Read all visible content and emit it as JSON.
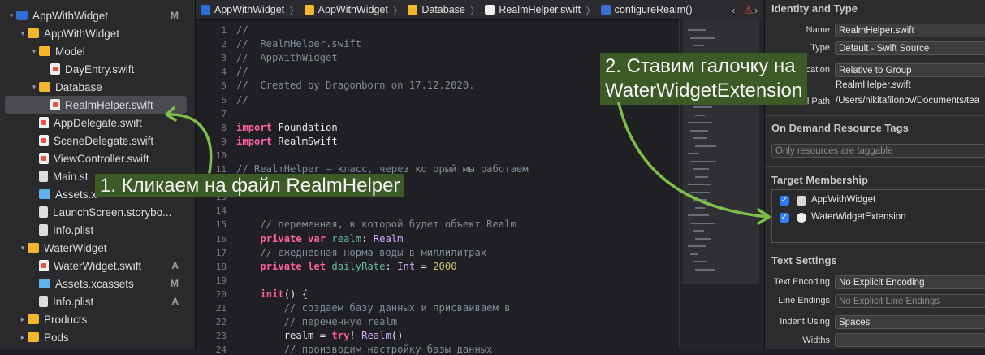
{
  "navigator": {
    "items": [
      {
        "label": "AppWithWidget",
        "badge": "M",
        "level": 0,
        "icon": "xcode-project-icon",
        "disc": "▾"
      },
      {
        "label": "AppWithWidget",
        "badge": "",
        "level": 1,
        "icon": "folder-icon",
        "disc": "▾"
      },
      {
        "label": "Model",
        "badge": "",
        "level": 2,
        "icon": "folder-icon",
        "disc": "▾"
      },
      {
        "label": "DayEntry.swift",
        "badge": "",
        "level": 3,
        "icon": "swift-file-icon",
        "disc": ""
      },
      {
        "label": "Database",
        "badge": "",
        "level": 2,
        "icon": "folder-icon",
        "disc": "▾"
      },
      {
        "label": "RealmHelper.swift",
        "badge": "",
        "level": 3,
        "icon": "swift-file-icon",
        "disc": "",
        "selected": true
      },
      {
        "label": "AppDelegate.swift",
        "badge": "",
        "level": 2,
        "icon": "swift-file-icon",
        "disc": ""
      },
      {
        "label": "SceneDelegate.swift",
        "badge": "",
        "level": 2,
        "icon": "swift-file-icon",
        "disc": ""
      },
      {
        "label": "ViewController.swift",
        "badge": "",
        "level": 2,
        "icon": "swift-file-icon",
        "disc": ""
      },
      {
        "label": "Main.st",
        "badge": "",
        "level": 2,
        "icon": "storyboard-icon",
        "disc": ""
      },
      {
        "label": "Assets.x",
        "badge": "",
        "level": 2,
        "icon": "assets-icon",
        "disc": ""
      },
      {
        "label": "LaunchScreen.storybo...",
        "badge": "",
        "level": 2,
        "icon": "storyboard-icon",
        "disc": ""
      },
      {
        "label": "Info.plist",
        "badge": "",
        "level": 2,
        "icon": "plist-icon",
        "disc": ""
      },
      {
        "label": "WaterWidget",
        "badge": "",
        "level": 1,
        "icon": "folder-icon",
        "disc": "▾"
      },
      {
        "label": "WaterWidget.swift",
        "badge": "A",
        "level": 2,
        "icon": "swift-file-icon",
        "disc": ""
      },
      {
        "label": "Assets.xcassets",
        "badge": "M",
        "level": 2,
        "icon": "assets-icon",
        "disc": ""
      },
      {
        "label": "Info.plist",
        "badge": "A",
        "level": 2,
        "icon": "plist-icon",
        "disc": ""
      },
      {
        "label": "Products",
        "badge": "",
        "level": 1,
        "icon": "folder-icon",
        "disc": "▸"
      },
      {
        "label": "Pods",
        "badge": "",
        "level": 1,
        "icon": "folder-icon",
        "disc": "▸"
      }
    ]
  },
  "jumpbar": {
    "crumbs": [
      "AppWithWidget",
      "AppWithWidget",
      "Database",
      "RealmHelper.swift",
      "configureRealm()"
    ],
    "sep": "〉",
    "buttons": [
      "‹",
      "⚠",
      "›"
    ]
  },
  "editor": {
    "lines": [
      {
        "n": "1",
        "t": "//",
        "k": "cm"
      },
      {
        "n": "2",
        "t": "//  RealmHelper.swift",
        "k": "cm"
      },
      {
        "n": "3",
        "t": "//  AppWithWidget",
        "k": "cm"
      },
      {
        "n": "4",
        "t": "//",
        "k": "cm"
      },
      {
        "n": "5",
        "t": "//  Created by Dragonborn on 17.12.2020.",
        "k": "cm"
      },
      {
        "n": "6",
        "t": "//",
        "k": "cm"
      },
      {
        "n": "7",
        "t": "",
        "k": ""
      },
      {
        "n": "8",
        "t": "import Foundation",
        "k": "imp"
      },
      {
        "n": "9",
        "t": "import RealmSwift",
        "k": "imp"
      },
      {
        "n": "10",
        "t": "",
        "k": ""
      },
      {
        "n": "11",
        "t": "// RealmHelper – класс, через который мы работаем",
        "k": "cm"
      },
      {
        "n": "12",
        "t": "",
        "k": ""
      },
      {
        "n": "13",
        "t": "",
        "k": ""
      },
      {
        "n": "14",
        "t": "",
        "k": ""
      },
      {
        "n": "15",
        "t": "    // переменная, в которой будет объект Realm",
        "k": "cm"
      },
      {
        "n": "16",
        "t": "    private var realm: Realm",
        "k": "decl"
      },
      {
        "n": "17",
        "t": "    // ежедневная норма воды в миллилитрах",
        "k": "cm"
      },
      {
        "n": "18",
        "t": "    private let dailyRate: Int = 2000",
        "k": "decl2"
      },
      {
        "n": "19",
        "t": "",
        "k": ""
      },
      {
        "n": "20",
        "t": "    init() {",
        "k": "init"
      },
      {
        "n": "21",
        "t": "        // создаем базу данных и присваиваем в",
        "k": "cm"
      },
      {
        "n": "22",
        "t": "        // переменную realm",
        "k": "cm"
      },
      {
        "n": "23",
        "t": "        realm = try! Realm()",
        "k": "try"
      },
      {
        "n": "24",
        "t": "        // производим настройку базы данных",
        "k": "cm"
      }
    ]
  },
  "inspector": {
    "identity_title": "Identity and Type",
    "name_label": "Name",
    "name_value": "RealmHelper.swift",
    "type_label": "Type",
    "type_value": "Default - Swift Source",
    "location_label": "Location",
    "location_value": "Relative to Group",
    "location_file": "RealmHelper.swift",
    "fullpath_label": "Full Path",
    "fullpath_value": "/Users/nikitafilonov/Documents/tea",
    "odr_title": "On Demand Resource Tags",
    "odr_placeholder": "Only resources are taggable",
    "target_title": "Target Membership",
    "targets": [
      {
        "label": "AppWithWidget",
        "checked": true,
        "icon": "app-target-icon"
      },
      {
        "label": "WaterWidgetExtension",
        "checked": true,
        "icon": "extension-target-icon"
      }
    ],
    "text_title": "Text Settings",
    "encoding_label": "Text Encoding",
    "encoding_value": "No Explicit Encoding",
    "lineendings_label": "Line Endings",
    "lineendings_value": "No Explicit Line Endings",
    "indent_label": "Indent Using",
    "indent_value": "Spaces",
    "widths_label": "Widths"
  },
  "annotations": {
    "step1": "1. Кликаем на файл RealmHelper",
    "step2_line1": "2. Ставим галочку на",
    "step2_line2": "WaterWidgetExtension",
    "color": "#3b5a25",
    "arrow_color": "#7cc04a"
  }
}
